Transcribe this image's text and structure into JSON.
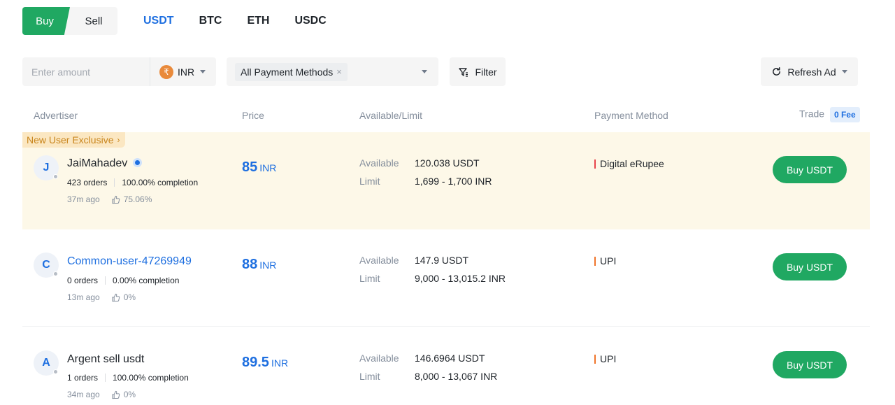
{
  "side": {
    "buy": "Buy",
    "sell": "Sell"
  },
  "coins": [
    "USDT",
    "BTC",
    "ETH",
    "USDC"
  ],
  "filters": {
    "amount_placeholder": "Enter amount",
    "currency": "INR",
    "currency_symbol": "₹",
    "payment": "All Payment Methods",
    "chip_close": "×",
    "filter_label": "Filter",
    "refresh_label": "Refresh Ad"
  },
  "table": {
    "headers": {
      "advertiser": "Advertiser",
      "price": "Price",
      "available": "Available/Limit",
      "payment": "Payment Method",
      "trade": "Trade",
      "fee_badge": "0 Fee"
    },
    "available_label": "Available",
    "limit_label": "Limit",
    "rows": [
      {
        "exclusive": "New User Exclusive",
        "initial": "J",
        "name": "JaiMahadev",
        "verified": true,
        "orders": "423 orders",
        "completion": "100.00% completion",
        "time": "37m ago",
        "rating": "75.06%",
        "price": "85",
        "price_currency": "INR",
        "available": "120.038 USDT",
        "limit": "1,699 - 1,700 INR",
        "payment": "Digital eRupee",
        "payment_color": "#e8434a",
        "button": "Buy USDT"
      },
      {
        "initial": "C",
        "name": "Common-user-47269949",
        "orders": "0 orders",
        "completion": "0.00% completion",
        "time": "13m ago",
        "rating": "0%",
        "price": "88",
        "price_currency": "INR",
        "available": "147.9 USDT",
        "limit": "9,000 - 13,015.2 INR",
        "payment": "UPI",
        "payment_color": "#f0742a",
        "button": "Buy USDT"
      },
      {
        "initial": "A",
        "name": "Argent sell usdt",
        "orders": "1 orders",
        "completion": "100.00% completion",
        "time": "34m ago",
        "rating": "0%",
        "price": "89.5",
        "price_currency": "INR",
        "available": "146.6964 USDT",
        "limit": "8,000 - 13,067 INR",
        "payment": "UPI",
        "payment_color": "#f0742a",
        "button": "Buy USDT"
      }
    ]
  }
}
